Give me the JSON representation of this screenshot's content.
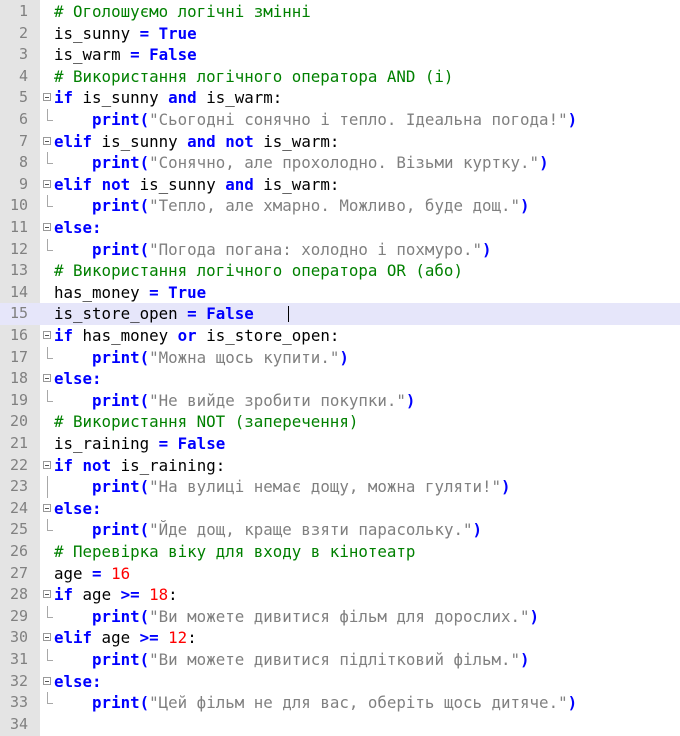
{
  "editor": {
    "lines": [
      {
        "n": "1",
        "fold": "none",
        "tokens": [
          {
            "t": "# Оголошуємо логічні змінні",
            "c": "cmt"
          }
        ]
      },
      {
        "n": "2",
        "fold": "none",
        "tokens": [
          {
            "t": "is_sunny ",
            "c": "txt"
          },
          {
            "t": "=",
            "c": "kw"
          },
          {
            "t": " ",
            "c": "txt"
          },
          {
            "t": "True",
            "c": "kw"
          }
        ]
      },
      {
        "n": "3",
        "fold": "none",
        "tokens": [
          {
            "t": "is_warm ",
            "c": "txt"
          },
          {
            "t": "=",
            "c": "kw"
          },
          {
            "t": " ",
            "c": "txt"
          },
          {
            "t": "False",
            "c": "kw"
          }
        ]
      },
      {
        "n": "4",
        "fold": "none",
        "tokens": [
          {
            "t": "# Використання логічного оператора AND (і)",
            "c": "cmt"
          }
        ]
      },
      {
        "n": "5",
        "fold": "open",
        "tokens": [
          {
            "t": "if",
            "c": "kw"
          },
          {
            "t": " is_sunny ",
            "c": "txt"
          },
          {
            "t": "and",
            "c": "kw"
          },
          {
            "t": " is_warm:",
            "c": "txt"
          }
        ]
      },
      {
        "n": "6",
        "fold": "end",
        "tokens": [
          {
            "t": "    ",
            "c": "txt"
          },
          {
            "t": "print",
            "c": "kw"
          },
          {
            "t": "(",
            "c": "kw"
          },
          {
            "t": "\"Сьогодні сонячно і тепло. Ідеальна погода!\"",
            "c": "str"
          },
          {
            "t": ")",
            "c": "kw"
          }
        ]
      },
      {
        "n": "7",
        "fold": "open",
        "tokens": [
          {
            "t": "elif",
            "c": "kw"
          },
          {
            "t": " is_sunny ",
            "c": "txt"
          },
          {
            "t": "and",
            "c": "kw"
          },
          {
            "t": " ",
            "c": "txt"
          },
          {
            "t": "not",
            "c": "kw"
          },
          {
            "t": " is_warm:",
            "c": "txt"
          }
        ]
      },
      {
        "n": "8",
        "fold": "end",
        "tokens": [
          {
            "t": "    ",
            "c": "txt"
          },
          {
            "t": "print",
            "c": "kw"
          },
          {
            "t": "(",
            "c": "kw"
          },
          {
            "t": "\"Сонячно, але прохолодно. Візьми куртку.\"",
            "c": "str"
          },
          {
            "t": ")",
            "c": "kw"
          }
        ]
      },
      {
        "n": "9",
        "fold": "open",
        "tokens": [
          {
            "t": "elif",
            "c": "kw"
          },
          {
            "t": " ",
            "c": "txt"
          },
          {
            "t": "not",
            "c": "kw"
          },
          {
            "t": " is_sunny ",
            "c": "txt"
          },
          {
            "t": "and",
            "c": "kw"
          },
          {
            "t": " is_warm:",
            "c": "txt"
          }
        ]
      },
      {
        "n": "10",
        "fold": "end",
        "tokens": [
          {
            "t": "    ",
            "c": "txt"
          },
          {
            "t": "print",
            "c": "kw"
          },
          {
            "t": "(",
            "c": "kw"
          },
          {
            "t": "\"Тепло, але хмарно. Можливо, буде дощ.\"",
            "c": "str"
          },
          {
            "t": ")",
            "c": "kw"
          }
        ]
      },
      {
        "n": "11",
        "fold": "open",
        "tokens": [
          {
            "t": "else:",
            "c": "kw"
          }
        ]
      },
      {
        "n": "12",
        "fold": "end",
        "tokens": [
          {
            "t": "    ",
            "c": "txt"
          },
          {
            "t": "print",
            "c": "kw"
          },
          {
            "t": "(",
            "c": "kw"
          },
          {
            "t": "\"Погода погана: холодно і похмуро.\"",
            "c": "str"
          },
          {
            "t": ")",
            "c": "kw"
          }
        ]
      },
      {
        "n": "13",
        "fold": "none",
        "tokens": [
          {
            "t": "# Використання логічного оператора OR (або)",
            "c": "cmt"
          }
        ]
      },
      {
        "n": "14",
        "fold": "none",
        "tokens": [
          {
            "t": "has_money ",
            "c": "txt"
          },
          {
            "t": "=",
            "c": "kw"
          },
          {
            "t": " ",
            "c": "txt"
          },
          {
            "t": "True",
            "c": "kw"
          }
        ]
      },
      {
        "n": "15",
        "fold": "none",
        "current": true,
        "tokens": [
          {
            "t": "is_store_open ",
            "c": "txt"
          },
          {
            "t": "=",
            "c": "kw"
          },
          {
            "t": " ",
            "c": "txt"
          },
          {
            "t": "False",
            "c": "kw"
          }
        ]
      },
      {
        "n": "16",
        "fold": "open",
        "tokens": [
          {
            "t": "if",
            "c": "kw"
          },
          {
            "t": " has_money ",
            "c": "txt"
          },
          {
            "t": "or",
            "c": "kw"
          },
          {
            "t": " is_store_open:",
            "c": "txt"
          }
        ]
      },
      {
        "n": "17",
        "fold": "end",
        "tokens": [
          {
            "t": "    ",
            "c": "txt"
          },
          {
            "t": "print",
            "c": "kw"
          },
          {
            "t": "(",
            "c": "kw"
          },
          {
            "t": "\"Можна щось купити.\"",
            "c": "str"
          },
          {
            "t": ")",
            "c": "kw"
          }
        ]
      },
      {
        "n": "18",
        "fold": "open",
        "tokens": [
          {
            "t": "else:",
            "c": "kw"
          }
        ]
      },
      {
        "n": "19",
        "fold": "end",
        "tokens": [
          {
            "t": "    ",
            "c": "txt"
          },
          {
            "t": "print",
            "c": "kw"
          },
          {
            "t": "(",
            "c": "kw"
          },
          {
            "t": "\"Не вийде зробити покупки.\"",
            "c": "str"
          },
          {
            "t": ")",
            "c": "kw"
          }
        ]
      },
      {
        "n": "20",
        "fold": "none",
        "tokens": [
          {
            "t": "# Використання NOT (заперечення)",
            "c": "cmt"
          }
        ]
      },
      {
        "n": "21",
        "fold": "none",
        "tokens": [
          {
            "t": "is_raining ",
            "c": "txt"
          },
          {
            "t": "=",
            "c": "kw"
          },
          {
            "t": " ",
            "c": "txt"
          },
          {
            "t": "False",
            "c": "kw"
          }
        ]
      },
      {
        "n": "22",
        "fold": "open",
        "tokens": [
          {
            "t": "if",
            "c": "kw"
          },
          {
            "t": " ",
            "c": "txt"
          },
          {
            "t": "not",
            "c": "kw"
          },
          {
            "t": " is_raining:",
            "c": "txt"
          }
        ]
      },
      {
        "n": "23",
        "fold": "vline",
        "tokens": [
          {
            "t": "    ",
            "c": "txt"
          },
          {
            "t": "print",
            "c": "kw"
          },
          {
            "t": "(",
            "c": "kw"
          },
          {
            "t": "\"На вулиці немає дощу, можна гуляти!\"",
            "c": "str"
          },
          {
            "t": ")",
            "c": "kw"
          }
        ]
      },
      {
        "n": "24",
        "fold": "open",
        "tokens": [
          {
            "t": "else:",
            "c": "kw"
          }
        ]
      },
      {
        "n": "25",
        "fold": "end",
        "tokens": [
          {
            "t": "    ",
            "c": "txt"
          },
          {
            "t": "print",
            "c": "kw"
          },
          {
            "t": "(",
            "c": "kw"
          },
          {
            "t": "\"Йде дощ, краще взяти парасольку.\"",
            "c": "str"
          },
          {
            "t": ")",
            "c": "kw"
          }
        ]
      },
      {
        "n": "26",
        "fold": "none",
        "tokens": [
          {
            "t": "# Перевірка віку для входу в кінотеатр",
            "c": "cmt"
          }
        ]
      },
      {
        "n": "27",
        "fold": "none",
        "tokens": [
          {
            "t": "age ",
            "c": "txt"
          },
          {
            "t": "=",
            "c": "kw"
          },
          {
            "t": " ",
            "c": "txt"
          },
          {
            "t": "16",
            "c": "num"
          }
        ]
      },
      {
        "n": "28",
        "fold": "open",
        "tokens": [
          {
            "t": "if",
            "c": "kw"
          },
          {
            "t": " age ",
            "c": "txt"
          },
          {
            "t": ">=",
            "c": "kw"
          },
          {
            "t": " ",
            "c": "txt"
          },
          {
            "t": "18",
            "c": "num"
          },
          {
            "t": ":",
            "c": "txt"
          }
        ]
      },
      {
        "n": "29",
        "fold": "end",
        "tokens": [
          {
            "t": "    ",
            "c": "txt"
          },
          {
            "t": "print",
            "c": "kw"
          },
          {
            "t": "(",
            "c": "kw"
          },
          {
            "t": "\"Ви можете дивитися фільм для дорослих.\"",
            "c": "str"
          },
          {
            "t": ")",
            "c": "kw"
          }
        ]
      },
      {
        "n": "30",
        "fold": "open",
        "tokens": [
          {
            "t": "elif",
            "c": "kw"
          },
          {
            "t": " age ",
            "c": "txt"
          },
          {
            "t": ">=",
            "c": "kw"
          },
          {
            "t": " ",
            "c": "txt"
          },
          {
            "t": "12",
            "c": "num"
          },
          {
            "t": ":",
            "c": "txt"
          }
        ]
      },
      {
        "n": "31",
        "fold": "end",
        "tokens": [
          {
            "t": "    ",
            "c": "txt"
          },
          {
            "t": "print",
            "c": "kw"
          },
          {
            "t": "(",
            "c": "kw"
          },
          {
            "t": "\"Ви можете дивитися підлітковий фільм.\"",
            "c": "str"
          },
          {
            "t": ")",
            "c": "kw"
          }
        ]
      },
      {
        "n": "32",
        "fold": "open",
        "tokens": [
          {
            "t": "else:",
            "c": "kw"
          }
        ]
      },
      {
        "n": "33",
        "fold": "end",
        "tokens": [
          {
            "t": "    ",
            "c": "txt"
          },
          {
            "t": "print",
            "c": "kw"
          },
          {
            "t": "(",
            "c": "kw"
          },
          {
            "t": "\"Цей фільм не для вас, оберіть щось дитяче.\"",
            "c": "str"
          },
          {
            "t": ")",
            "c": "kw"
          }
        ]
      },
      {
        "n": "34",
        "fold": "none",
        "tokens": []
      }
    ]
  },
  "colors": {
    "keyword": "#0000ff",
    "string": "#808080",
    "number": "#ff0000",
    "comment": "#008000",
    "text": "#000000",
    "gutter": "#e4e4e4",
    "current_line": "#e6e6fa"
  }
}
